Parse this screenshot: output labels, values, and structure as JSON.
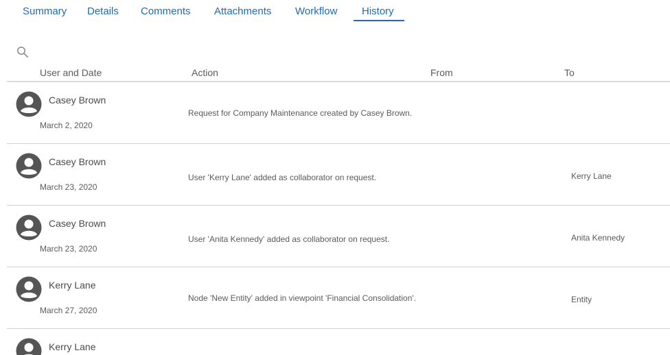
{
  "tabs": [
    {
      "label": "Summary"
    },
    {
      "label": "Details"
    },
    {
      "label": "Comments"
    },
    {
      "label": "Attachments"
    },
    {
      "label": "Workflow"
    },
    {
      "label": "History"
    }
  ],
  "active_tab": "History",
  "colors": {
    "accent": "#1f6bb5",
    "divider": "#c9d3de",
    "avatar": "#555555"
  },
  "table": {
    "headers": {
      "user_and_date": "User and Date",
      "action": "Action",
      "from": "From",
      "to": "To"
    },
    "rows": [
      {
        "user": "Casey Brown",
        "date": "March 2, 2020",
        "action": "Request for Company Maintenance created by Casey Brown.",
        "from": "",
        "to": ""
      },
      {
        "user": "Casey Brown",
        "date": "March 23, 2020",
        "action": "User 'Kerry Lane' added as collaborator on request.",
        "from": "",
        "to": "Kerry Lane"
      },
      {
        "user": "Casey Brown",
        "date": "March 23, 2020",
        "action": "User 'Anita Kennedy' added as collaborator on request.",
        "from": "",
        "to": "Anita Kennedy"
      },
      {
        "user": "Kerry Lane",
        "date": "March 27, 2020",
        "action": "Node 'New Entity' added in viewpoint 'Financial Consolidation'.",
        "from": "",
        "to": "Entity"
      },
      {
        "user": "Kerry Lane",
        "date": "",
        "action": "",
        "from": "",
        "to": ""
      }
    ]
  }
}
